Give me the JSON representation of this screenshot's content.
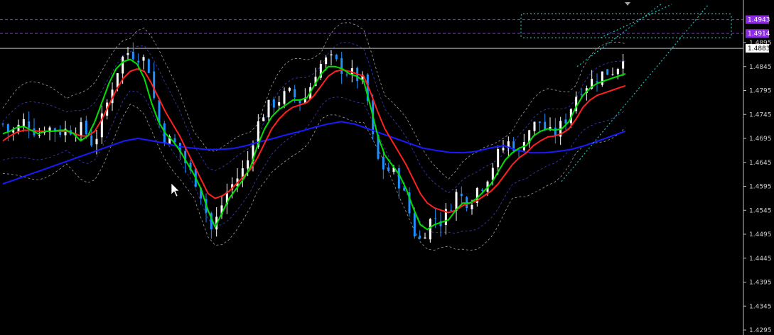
{
  "chart_data": {
    "type": "candlestick",
    "y_axis_labels": [
      "1.4895",
      "1.4845",
      "1.4795",
      "1.4745",
      "1.4695",
      "1.4645",
      "1.4595",
      "1.4545",
      "1.4495",
      "1.4445",
      "1.4395",
      "1.4345",
      "1.4295"
    ],
    "ylim": [
      1.4285,
      1.4975
    ],
    "price_badges": [
      {
        "value": "1.4943",
        "color": "#8a2be2",
        "text_color": "#ffffff"
      },
      {
        "value": "1.4914",
        "color": "#8a2be2",
        "text_color": "#ffffff"
      },
      {
        "value": "1.4883",
        "color": "#ffffff",
        "text_color": "#000000"
      }
    ],
    "horizontal_lines": [
      {
        "value": 1.4943,
        "style": "dashed",
        "color": "#8a2be2"
      },
      {
        "value": 1.4914,
        "style": "dashed",
        "color": "#8a2be2"
      },
      {
        "value": 1.4883,
        "style": "solid",
        "color": "#c0c0c0"
      }
    ],
    "candle_count": 120,
    "candle_colors": {
      "up": "#ffffff",
      "down": "#1e90ff"
    },
    "closes": [
      1.4725,
      1.4705,
      1.4715,
      1.473,
      1.4725,
      1.47,
      1.472,
      1.4715,
      1.471,
      1.4712,
      1.4715,
      1.4718,
      1.4705,
      1.468,
      1.4725,
      1.477,
      1.482,
      1.486,
      1.4875,
      1.487,
      1.4865,
      1.484,
      1.475,
      1.47,
      1.469,
      1.468,
      1.465,
      1.462,
      1.46,
      1.455,
      1.45,
      1.454,
      1.458,
      1.46,
      1.462,
      1.464,
      1.47,
      1.474,
      1.476,
      1.477,
      1.478,
      1.479,
      1.478,
      1.477,
      1.48,
      1.484,
      1.4855,
      1.486,
      1.485,
      1.4835,
      1.483,
      1.482,
      1.481,
      1.47,
      1.464,
      1.463,
      1.4625,
      1.46,
      1.456,
      1.45,
      1.448,
      1.452,
      1.453,
      1.452,
      1.455,
      1.458,
      1.457,
      1.456,
      1.459,
      1.46,
      1.463,
      1.466,
      1.468,
      1.469,
      1.466,
      1.471,
      1.472,
      1.473,
      1.471,
      1.47,
      1.472,
      1.474,
      1.478,
      1.48,
      1.481,
      1.482,
      1.483,
      1.4835,
      1.484,
      1.487
    ],
    "indicators": {
      "fast_ma": {
        "color": "#00e000",
        "values": [
          1.4705,
          1.471,
          1.4718,
          1.472,
          1.4712,
          1.4705,
          1.471,
          1.471,
          1.4712,
          1.4712,
          1.4705,
          1.469,
          1.47,
          1.473,
          1.477,
          1.481,
          1.484,
          1.4855,
          1.486,
          1.485,
          1.482,
          1.477,
          1.473,
          1.4705,
          1.469,
          1.467,
          1.4645,
          1.462,
          1.459,
          1.4545,
          1.451,
          1.454,
          1.457,
          1.459,
          1.461,
          1.4635,
          1.468,
          1.4715,
          1.474,
          1.4755,
          1.4765,
          1.4775,
          1.4775,
          1.478,
          1.4805,
          1.483,
          1.4845,
          1.4845,
          1.484,
          1.483,
          1.4825,
          1.4815,
          1.476,
          1.47,
          1.466,
          1.464,
          1.462,
          1.459,
          1.455,
          1.4515,
          1.4505,
          1.4515,
          1.452,
          1.4525,
          1.4545,
          1.456,
          1.456,
          1.457,
          1.4585,
          1.46,
          1.4625,
          1.465,
          1.4665,
          1.4675,
          1.468,
          1.47,
          1.471,
          1.4715,
          1.4712,
          1.4715,
          1.473,
          1.476,
          1.4785,
          1.48,
          1.481,
          1.4815,
          1.482,
          1.4825,
          1.483
        ]
      },
      "slow_ma": {
        "color": "#ff2020",
        "values": [
          1.469,
          1.47,
          1.4708,
          1.4712,
          1.4712,
          1.471,
          1.471,
          1.471,
          1.471,
          1.471,
          1.4706,
          1.47,
          1.47,
          1.471,
          1.4735,
          1.4765,
          1.4795,
          1.482,
          1.4835,
          1.484,
          1.4835,
          1.481,
          1.478,
          1.475,
          1.4725,
          1.47,
          1.467,
          1.464,
          1.461,
          1.458,
          1.457,
          1.4575,
          1.4585,
          1.46,
          1.4615,
          1.463,
          1.4655,
          1.4685,
          1.4715,
          1.4735,
          1.475,
          1.476,
          1.4765,
          1.477,
          1.4785,
          1.4805,
          1.4825,
          1.4835,
          1.4838,
          1.4835,
          1.483,
          1.4825,
          1.479,
          1.475,
          1.4715,
          1.469,
          1.4665,
          1.464,
          1.461,
          1.458,
          1.456,
          1.455,
          1.4545,
          1.454,
          1.4545,
          1.4555,
          1.456,
          1.4565,
          1.4575,
          1.4585,
          1.46,
          1.462,
          1.464,
          1.4655,
          1.4665,
          1.468,
          1.469,
          1.4698,
          1.47,
          1.4705,
          1.4715,
          1.4735,
          1.476,
          1.4775,
          1.4785,
          1.479,
          1.4795,
          1.48,
          1.4805
        ]
      },
      "long_ma": {
        "color": "#1a1aff",
        "values": [
          1.46,
          1.461,
          1.462,
          1.463,
          1.464,
          1.465,
          1.466,
          1.467,
          1.468,
          1.469,
          1.4695,
          1.469,
          1.4685,
          1.4678,
          1.4675,
          1.4672,
          1.4672,
          1.4674,
          1.468,
          1.4688,
          1.4695,
          1.4703,
          1.471,
          1.4718,
          1.4725,
          1.473,
          1.4725,
          1.4715,
          1.4705,
          1.4695,
          1.4685,
          1.4675,
          1.467,
          1.4666,
          1.4665,
          1.4668,
          1.4675,
          1.468,
          1.467,
          1.4665,
          1.4665,
          1.4668,
          1.4672,
          1.468,
          1.469,
          1.47,
          1.471
        ]
      },
      "bollinger_upper": {
        "color": "#a0a0a0",
        "style": "dashed"
      },
      "bollinger_lower": {
        "color": "#a0a0a0",
        "style": "dashed"
      },
      "envelope": {
        "color": "#4040c0",
        "style": "dashed"
      }
    },
    "trend_channel": {
      "color": "#20c0c0",
      "style": "dotted"
    },
    "rectangle": {
      "color": "#20c0c0",
      "style": "dotted",
      "top": 1.4955,
      "bottom": 1.4905
    }
  }
}
